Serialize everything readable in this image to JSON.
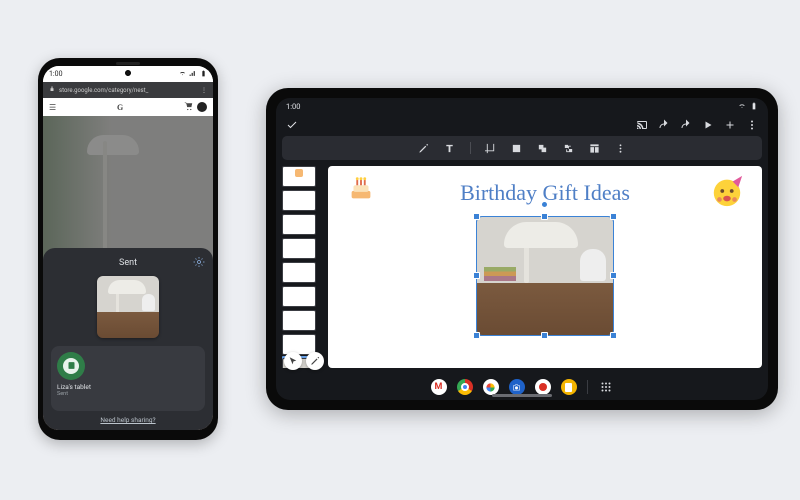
{
  "phone": {
    "status": {
      "time": "1:00"
    },
    "urlbar": {
      "url": "store.google.com/category/nest_"
    },
    "toprow": {
      "logo": "G"
    },
    "share": {
      "title": "Sent",
      "target": {
        "name": "Liza's tablet",
        "status": "Sent"
      },
      "help_text": "Need help sharing?"
    }
  },
  "tablet": {
    "status": {
      "time": "1:00"
    },
    "canvas": {
      "title": "Birthday Gift Ideas"
    },
    "thumbs": {
      "count": 9,
      "active_index": 8
    }
  }
}
